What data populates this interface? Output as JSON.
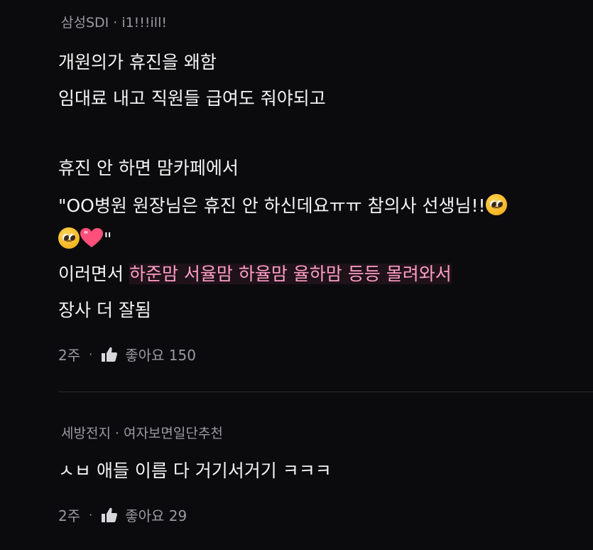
{
  "comments": [
    {
      "author": "삼성SDI",
      "separator": "·",
      "badge": "i1!!!ill!",
      "lines": {
        "l1": "개원의가 휴진을 왜함",
        "l2": " 임대료 내고 직원들 급여도 줘야되고",
        "l3": "휴진 안 하면 맘카페에서",
        "l4": "\"OO병원 원장님은 휴진 안 하신데요ㅠㅠ 참의사 선생님!!",
        "l5_end": "\"",
        "l6_pre": "이러면서 ",
        "l6_highlight": "하준맘 서율맘 하율맘 율하맘 등등 몰려와서",
        "l7": " 장사 더 잘됨"
      },
      "emojis": [
        "pleading-face-emoji",
        "pleading-face-emoji",
        "heart-emoji"
      ],
      "time": "2주",
      "dot": "·",
      "like_label": "좋아요 150"
    },
    {
      "author": "세방전지",
      "separator": "·",
      "badge": "여자보면일단추천",
      "lines": {
        "l1": "ㅅㅂ 애들 이름 다 거기서거기 ㅋㅋㅋ"
      },
      "time": "2주",
      "dot": "·",
      "like_label": "좋아요 29"
    }
  ],
  "colors": {
    "background": "#0b0b0d",
    "text": "#f4f4f4",
    "muted": "#9a9aa0",
    "highlight": "#ff9ec8"
  }
}
